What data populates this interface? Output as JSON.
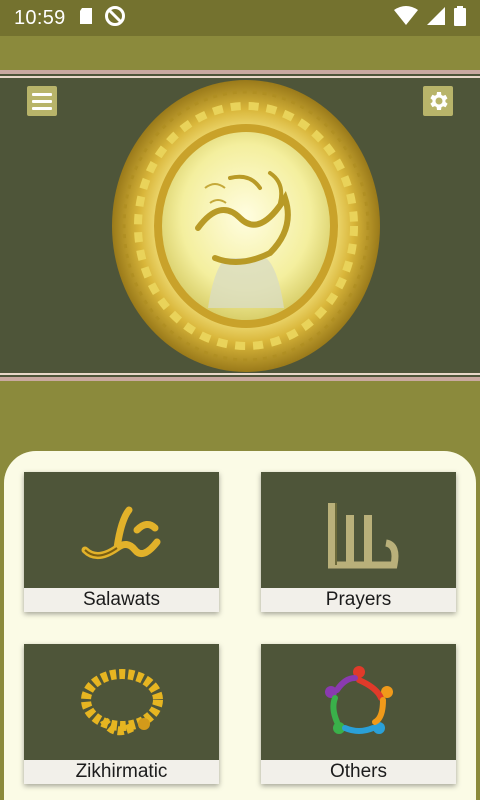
{
  "status_bar": {
    "time": "10:59",
    "icons": [
      "sd-card-icon",
      "no-disturb-icon",
      "wifi-icon",
      "signal-icon",
      "battery-icon"
    ]
  },
  "header": {
    "menu_icon": "hamburger-menu-icon",
    "settings_icon": "gear-icon",
    "image": "muhammad-calligraphy-medallion"
  },
  "tiles": [
    {
      "label": "Salawats",
      "icon": "muhammad-calligraphy-icon"
    },
    {
      "label": "Prayers",
      "icon": "allah-calligraphy-icon"
    },
    {
      "label": "Zikhirmatic",
      "icon": "prayer-beads-icon"
    },
    {
      "label": "Others",
      "icon": "colorful-people-circle-icon"
    }
  ],
  "colors": {
    "olive": "#8b8a3c",
    "dark_olive": "#4e5539",
    "status_bar": "#74722f",
    "card_bg": "#fbfbe6",
    "gold": "#d8b43a"
  }
}
